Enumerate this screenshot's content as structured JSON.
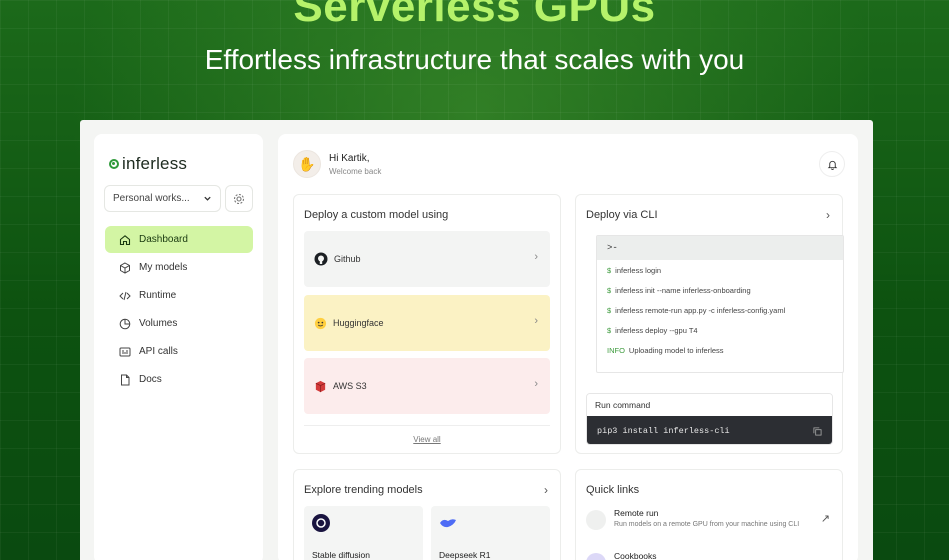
{
  "hero": {
    "title": "Serverless GPUs",
    "subtitle": "Effortless infrastructure that scales with you"
  },
  "sidebar": {
    "logo": "inferless",
    "workspace": "Personal works...",
    "items": [
      {
        "label": "Dashboard",
        "icon": "home-icon",
        "active": true
      },
      {
        "label": "My models",
        "icon": "cube-icon"
      },
      {
        "label": "Runtime",
        "icon": "code-icon"
      },
      {
        "label": "Volumes",
        "icon": "pie-icon"
      },
      {
        "label": "API calls",
        "icon": "api-icon"
      },
      {
        "label": "Docs",
        "icon": "doc-icon"
      }
    ]
  },
  "header": {
    "greeting": "Hi Kartik,",
    "subtitle": "Welcome back"
  },
  "deploy": {
    "title": "Deploy a custom model using",
    "sources": [
      {
        "label": "Github",
        "icon": "github-icon"
      },
      {
        "label": "Huggingface",
        "icon": "huggingface-icon"
      },
      {
        "label": "AWS S3",
        "icon": "aws-s3-icon"
      }
    ],
    "view_all": "View all"
  },
  "cli": {
    "title": "Deploy via CLI",
    "prompt": ">-",
    "lines": [
      {
        "prefix": "$",
        "text": "inferless login"
      },
      {
        "prefix": "$",
        "text": "inferless init --name inferless-onboarding"
      },
      {
        "prefix": "$",
        "text": "inferless remote-run app.py -c inferless-config.yaml"
      },
      {
        "prefix": "$",
        "text": "inferless deploy --gpu T4"
      },
      {
        "prefix": "INFO",
        "text": "Uploading model to inferless"
      }
    ],
    "run_command_label": "Run command",
    "run_command": "pip3 install inferless-cli"
  },
  "trending": {
    "title": "Explore trending models",
    "models": [
      {
        "name": "Stable diffusion",
        "icon": "stable-diffusion-icon"
      },
      {
        "name": "Deepseek R1",
        "icon": "deepseek-icon"
      }
    ]
  },
  "quick_links": {
    "title": "Quick links",
    "items": [
      {
        "title": "Remote run",
        "desc": "Run models on a remote GPU from your machine using CLI"
      },
      {
        "title": "Cookbooks",
        "desc": ""
      }
    ]
  },
  "colors": {
    "accent": "#b5f26a",
    "active_nav": "#d3f5a4",
    "background": "#0b4a12"
  }
}
